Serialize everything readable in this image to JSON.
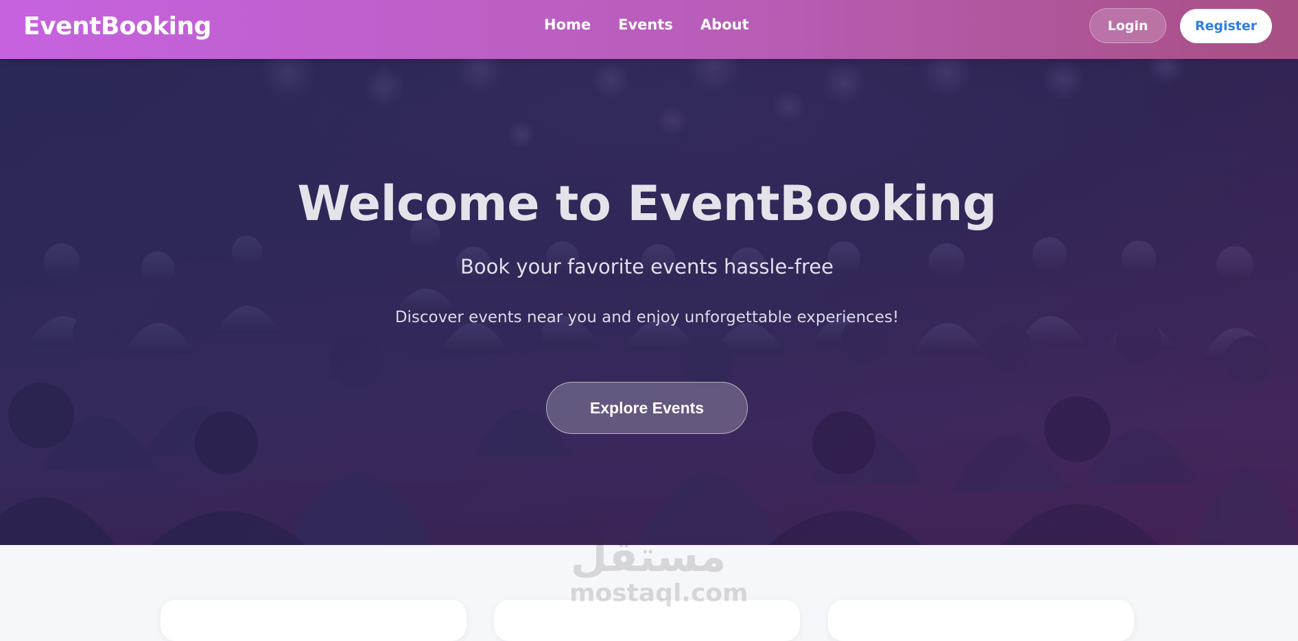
{
  "nav": {
    "brand": "EventBooking",
    "links": [
      "Home",
      "Events",
      "About"
    ],
    "login_label": "Login",
    "register_label": "Register"
  },
  "hero": {
    "title": "Welcome to EventBooking",
    "subtitle": "Book your favorite events hassle-free",
    "text": "Discover events near you and enjoy unforgettable experiences!",
    "cta_label": "Explore Events"
  },
  "watermark": {
    "arabic": "مستقل",
    "latin": "mostaql.com"
  },
  "colors": {
    "nav_gradient_start": "#c662e0",
    "nav_gradient_end": "#a84f84",
    "register_text": "#2b7de9",
    "hero_overlay": "#2c285c",
    "page_background": "#f6f7fb"
  }
}
